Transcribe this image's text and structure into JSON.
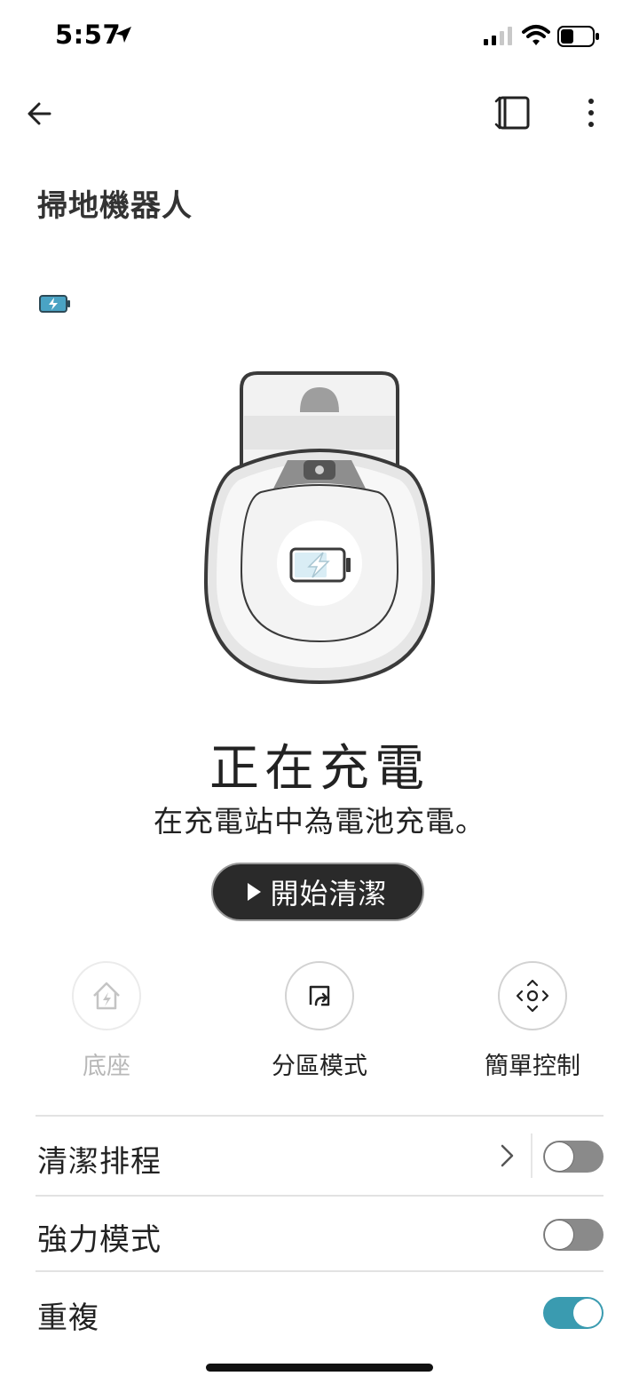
{
  "status_bar": {
    "time": "5:57",
    "icons": [
      "location-arrow-icon",
      "signal-icon",
      "wifi-icon",
      "battery-icon"
    ]
  },
  "header": {
    "title": "掃地機器人",
    "icons": [
      "back-arrow-icon",
      "rotate-screen-icon",
      "more-vert-icon"
    ]
  },
  "device": {
    "battery_state": "charging",
    "status_title": "正在充電",
    "status_description": "在充電站中為電池充電。",
    "start_button_label": "開始清潔"
  },
  "quick_actions": [
    {
      "label": "底座",
      "icon": "home-charge-icon",
      "enabled": false
    },
    {
      "label": "分區模式",
      "icon": "zone-mode-icon",
      "enabled": true
    },
    {
      "label": "簡單控制",
      "icon": "direction-pad-icon",
      "enabled": true
    }
  ],
  "settings": [
    {
      "label": "清潔排程",
      "has_detail": true,
      "enabled": false
    },
    {
      "label": "強力模式",
      "has_detail": false,
      "enabled": false
    },
    {
      "label": "重複",
      "has_detail": false,
      "enabled": true
    }
  ],
  "colors": {
    "accent": "#3a9bb0",
    "toggle_off": "#8a8a8a",
    "button_dark": "#2a2a2a",
    "battery_accent": "#4aa3c4"
  }
}
